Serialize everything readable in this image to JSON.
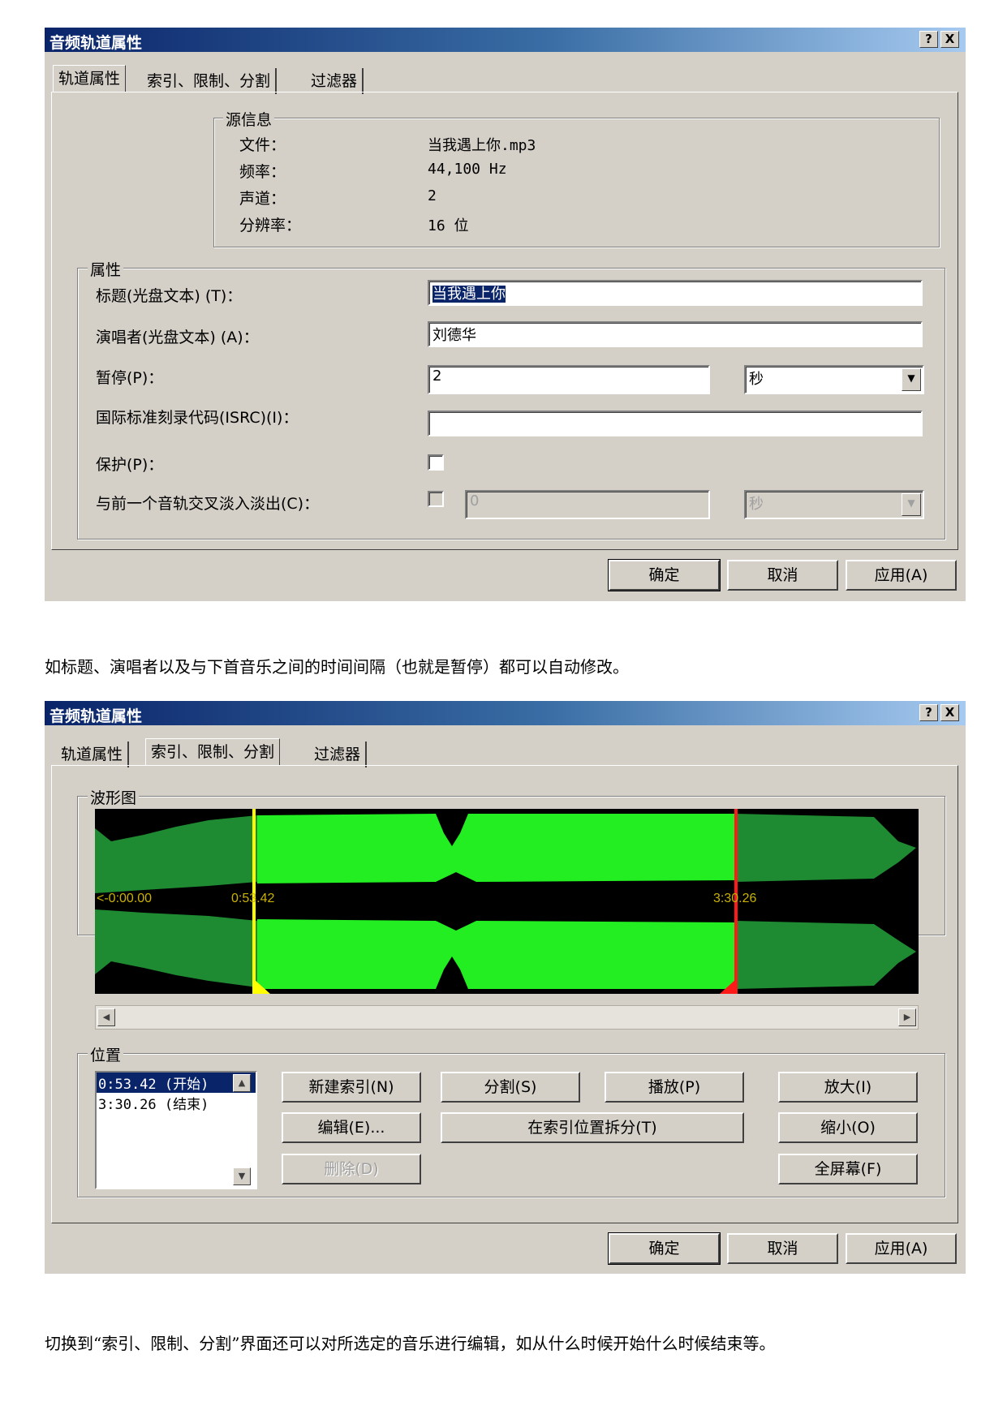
{
  "dialog1": {
    "title": "音频轨道属性",
    "help_btn": "?",
    "close_btn": "X",
    "tabs": [
      "轨道属性",
      "索引、限制、分割",
      "过滤器"
    ],
    "source_info": {
      "legend": "源信息",
      "file_label": "文件：",
      "file_value": "当我遇上你.mp3",
      "freq_label": "频率：",
      "freq_value": "44,100 Hz",
      "channel_label": "声道：",
      "channel_value": "2",
      "res_label": "分辨率：",
      "res_value": "16 位"
    },
    "props": {
      "legend": "属性",
      "title_label": "标题(光盘文本) (T)：",
      "title_value": "当我遇上你",
      "artist_label": "演唱者(光盘文本) (A)：",
      "artist_value": "刘德华",
      "pause_label": "暂停(P)：",
      "pause_value": "2",
      "pause_unit": "秒",
      "isrc_label": "国际标准刻录代码(ISRC)(I)：",
      "isrc_value": "",
      "protect_label": "保护(P)：",
      "crossfade_label": "与前一个音轨交叉淡入淡出(C)：",
      "crossfade_value": "0",
      "crossfade_unit": "秒"
    },
    "buttons": {
      "ok": "确定",
      "cancel": "取消",
      "apply": "应用(A)"
    }
  },
  "caption1": "如标题、演唱者以及与下首音乐之间的时间间隔（也就是暂停）都可以自动修改。",
  "dialog2": {
    "title": "音频轨道属性",
    "help_btn": "?",
    "close_btn": "X",
    "tabs": [
      "轨道属性",
      "索引、限制、分割",
      "过滤器"
    ],
    "waveform": {
      "legend": "波形图",
      "start_marker": "<-0:00.00",
      "marker_a": "0:53.42",
      "marker_b": "3:30.26"
    },
    "position": {
      "legend": "位置",
      "items": [
        "0:53.42 (开始)",
        "3:30.26 (结束)"
      ]
    },
    "buttons": {
      "new_index": "新建索引(N)",
      "split": "分割(S)",
      "play": "播放(P)",
      "zoom_in": "放大(I)",
      "edit": "编辑(E)...",
      "split_at_index": "在索引位置拆分(T)",
      "zoom_out": "缩小(O)",
      "delete": "删除(D)",
      "fullscreen": "全屏幕(F)",
      "ok": "确定",
      "cancel": "取消",
      "apply": "应用(A)"
    }
  },
  "caption2": "切换到“索引、限制、分割”界面还可以对所选定的音乐进行编辑，如从什么时候开始什么时候结束等。"
}
